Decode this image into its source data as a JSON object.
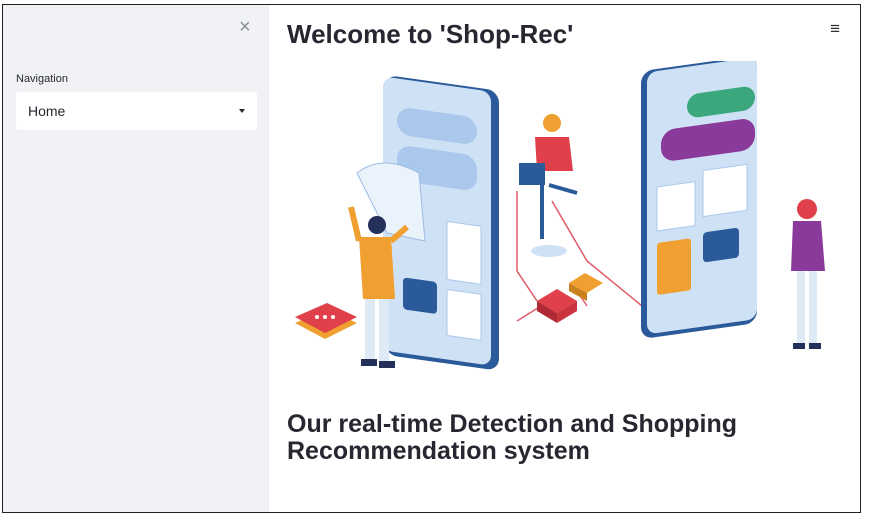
{
  "sidebar": {
    "close_label": "×",
    "nav_label": "Navigation",
    "select_value": "Home"
  },
  "header": {
    "title": "Welcome to 'Shop-Rec'",
    "menu_label": "≡"
  },
  "main": {
    "subtitle": "Our real-time Detection and Shopping Recommendation system"
  },
  "colors": {
    "sidebar_bg": "#f0f2f6",
    "text": "#262730",
    "phone_blue": "#2a5a9a",
    "green": "#3aa77d",
    "purple": "#8a3a9a",
    "orange": "#f0a030",
    "red": "#e0404a"
  }
}
